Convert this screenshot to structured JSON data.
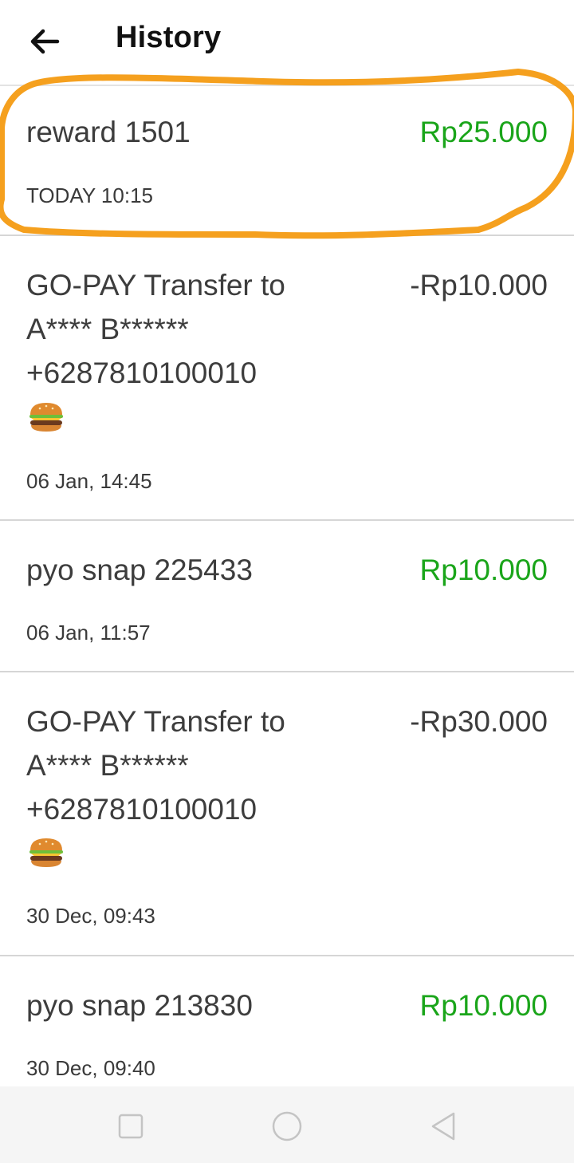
{
  "header": {
    "title": "History"
  },
  "transactions": [
    {
      "description": "reward 1501",
      "amount": "Rp25.000",
      "time": "TODAY 10:15",
      "highlighted": true
    },
    {
      "description": "GO-PAY Transfer to\nA**** B******\n+6287810100010",
      "amount": "-Rp10.000",
      "time": "06 Jan, 14:45",
      "emoji": "burger-icon"
    },
    {
      "description": "pyo snap 225433",
      "amount": "Rp10.000",
      "time": "06 Jan, 11:57"
    },
    {
      "description": "GO-PAY Transfer to\nA**** B******\n+6287810100010",
      "amount": "-Rp30.000",
      "time": "30 Dec, 09:43",
      "emoji": "burger-icon"
    },
    {
      "description": "pyo snap 213830",
      "amount": "Rp10.000",
      "time": "30 Dec, 09:40"
    }
  ],
  "colors": {
    "credit": "#1aa51a",
    "debit": "#3d3d3d",
    "highlight": "#f5a01e"
  },
  "navbar": {
    "items": [
      "recents-icon",
      "home-icon",
      "back-triangle-icon"
    ]
  }
}
